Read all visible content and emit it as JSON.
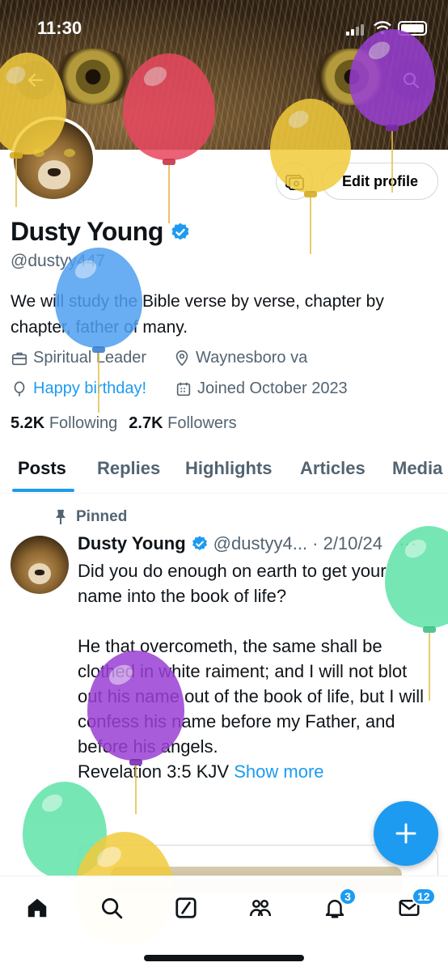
{
  "status_bar": {
    "time": "11:30"
  },
  "profile": {
    "edit_profile_label": "Edit profile",
    "name": "Dusty Young",
    "handle": "@dustyy447",
    "bio": "We will study the Bible verse by verse, chapter by chapter, father of many.",
    "occupation": "Spiritual Leader",
    "location": "Waynesboro va",
    "birthday": "Happy birthday!",
    "joined": "Joined October 2023",
    "following_count": "5.2K",
    "following_label": "Following",
    "followers_count": "2.7K",
    "followers_label": "Followers"
  },
  "tabs": [
    {
      "label": "Posts",
      "active": true
    },
    {
      "label": "Replies"
    },
    {
      "label": "Highlights"
    },
    {
      "label": "Articles"
    },
    {
      "label": "Media"
    }
  ],
  "post": {
    "pinned_label": "Pinned",
    "author": "Dusty Young",
    "handle": "@dustyy4...",
    "date": "· 2/10/24",
    "more": "···",
    "text": "Did you do enough on earth to get your name into the book of life?\n\nHe that overcometh, the same shall be clothed in white raiment; and I will not blot out his name out of the book of life, but I will confess his name before my Father, and before his angels.\nRevelation 3:5 KJV",
    "show_more": "Show more"
  },
  "bottom_nav": {
    "items": [
      "home-icon",
      "search-icon",
      "grok-icon",
      "communities-icon",
      "notifications-icon",
      "messages-icon"
    ],
    "notifications_badge": "3",
    "messages_badge": "12"
  },
  "colors": {
    "accent": "#1d9bf0",
    "text": "#0f1419",
    "secondary": "#536471",
    "balloon_yellow": "#f2cb3c",
    "balloon_red": "#e8475f",
    "balloon_purple": "#9a3fd4",
    "balloon_blue": "#4f9ff0",
    "balloon_green": "#5fe3a8"
  }
}
